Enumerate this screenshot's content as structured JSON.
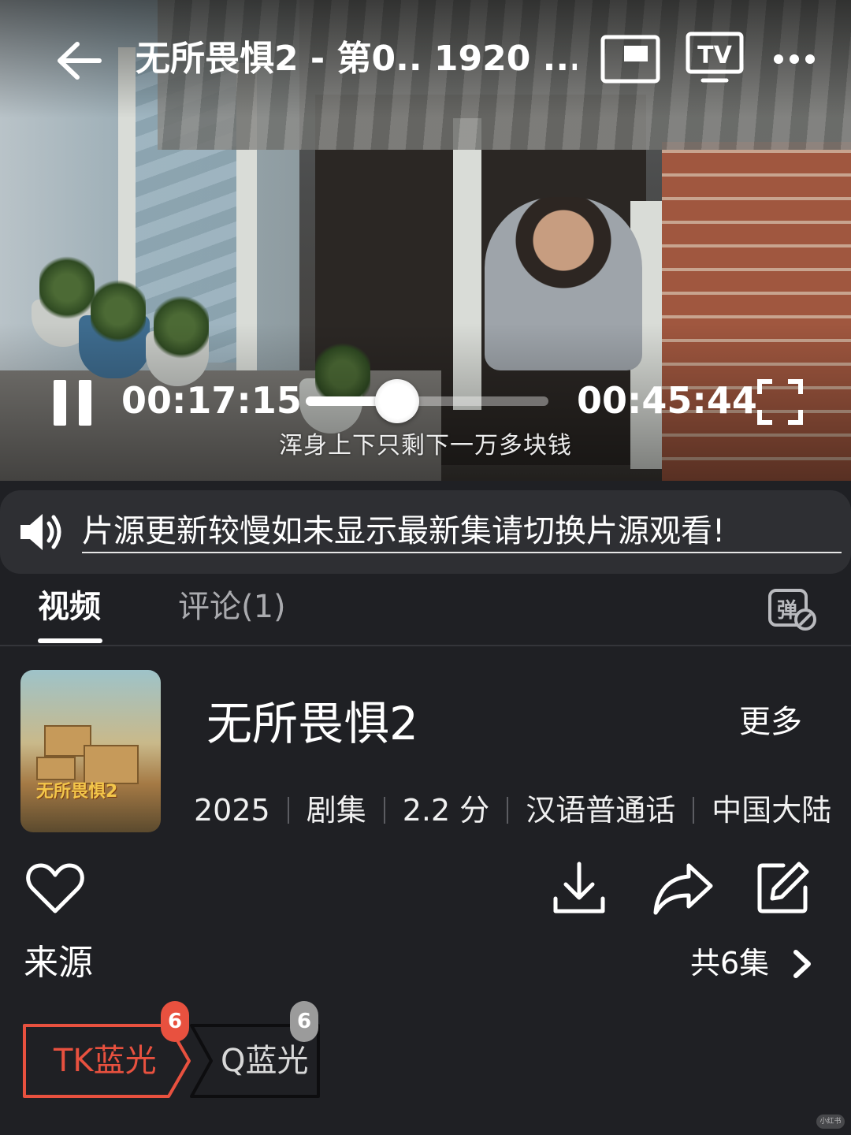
{
  "player": {
    "title": "无所畏惧2 - 第0.. 1920 ...",
    "current_time": "00:17:15",
    "total_time": "00:45:44",
    "progress": 0.378,
    "subtitle": "浑身上下只剩下一万多块钱",
    "pip_icon": "picture-in-picture-icon",
    "tv_label": "TV",
    "more_icon": "more-dots-icon"
  },
  "notice": {
    "text": "片源更新较慢如未显示最新集请切换片源观看!",
    "icon": "speaker-icon"
  },
  "tabs": {
    "video": "视频",
    "comments": "评论(1)",
    "danmaku_label": "弹"
  },
  "show": {
    "poster_title": "无所畏惧2",
    "title": "无所畏惧2",
    "more": "更多",
    "meta": [
      "2025",
      "剧集",
      "2.2 分",
      "汉语普通话",
      "中国大陆"
    ]
  },
  "actions": {
    "favorite": "heart-icon",
    "download": "download-icon",
    "share": "share-icon",
    "edit": "edit-icon"
  },
  "sources": {
    "label": "来源",
    "episodes": "共6集",
    "items": [
      {
        "name": "TK蓝光",
        "count": "6",
        "selected": true,
        "color": "#e8513f"
      },
      {
        "name": "Q蓝光",
        "count": "6",
        "selected": false,
        "color": "#9b9b9b"
      }
    ]
  },
  "watermark": "小红书"
}
